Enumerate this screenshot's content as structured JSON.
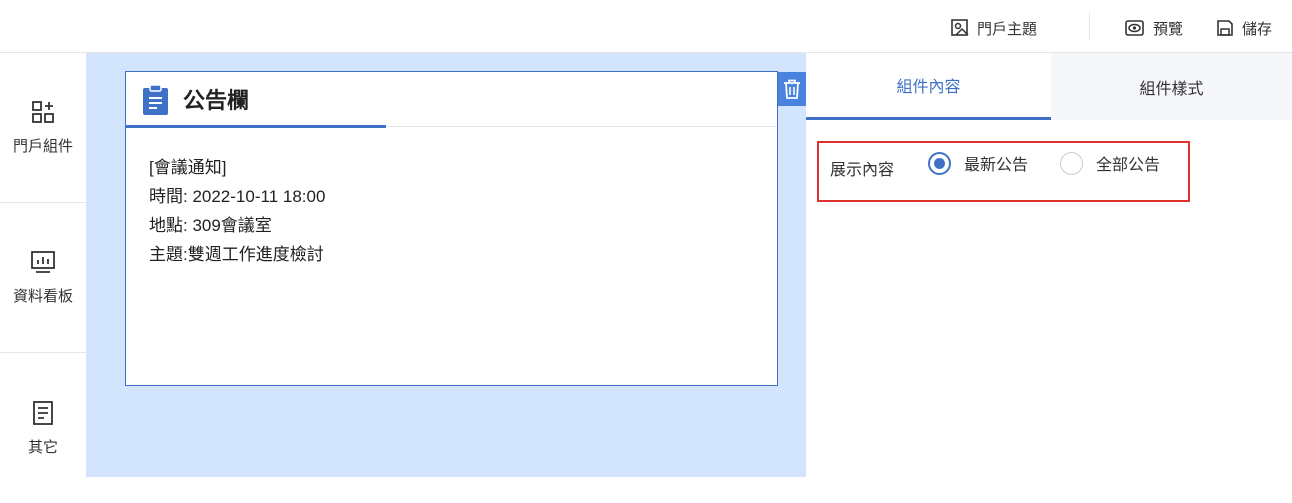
{
  "toolbar": {
    "theme_label": "門戶主題",
    "preview_label": "預覽",
    "save_label": "儲存"
  },
  "sidebar": {
    "items": [
      {
        "label": "門戶組件",
        "icon": "components-icon"
      },
      {
        "label": "資料看板",
        "icon": "dashboard-icon"
      },
      {
        "label": "其它",
        "icon": "document-icon"
      }
    ]
  },
  "widget": {
    "title": "公告欄",
    "icon": "clipboard-icon",
    "lines": [
      "[會議通知]",
      "時間: 2022-10-11 18:00",
      "地點: 309會議室",
      "主題:雙週工作進度檢討"
    ]
  },
  "panel": {
    "tabs": [
      {
        "label": "組件內容",
        "active": true
      },
      {
        "label": "組件樣式",
        "active": false
      }
    ],
    "field_label": "展示內容",
    "options": [
      {
        "label": "最新公告",
        "selected": true
      },
      {
        "label": "全部公告",
        "selected": false
      }
    ]
  },
  "colors": {
    "accent": "#3f72c7",
    "canvas_bg": "#d3e5fc",
    "highlight": "#e03131"
  }
}
